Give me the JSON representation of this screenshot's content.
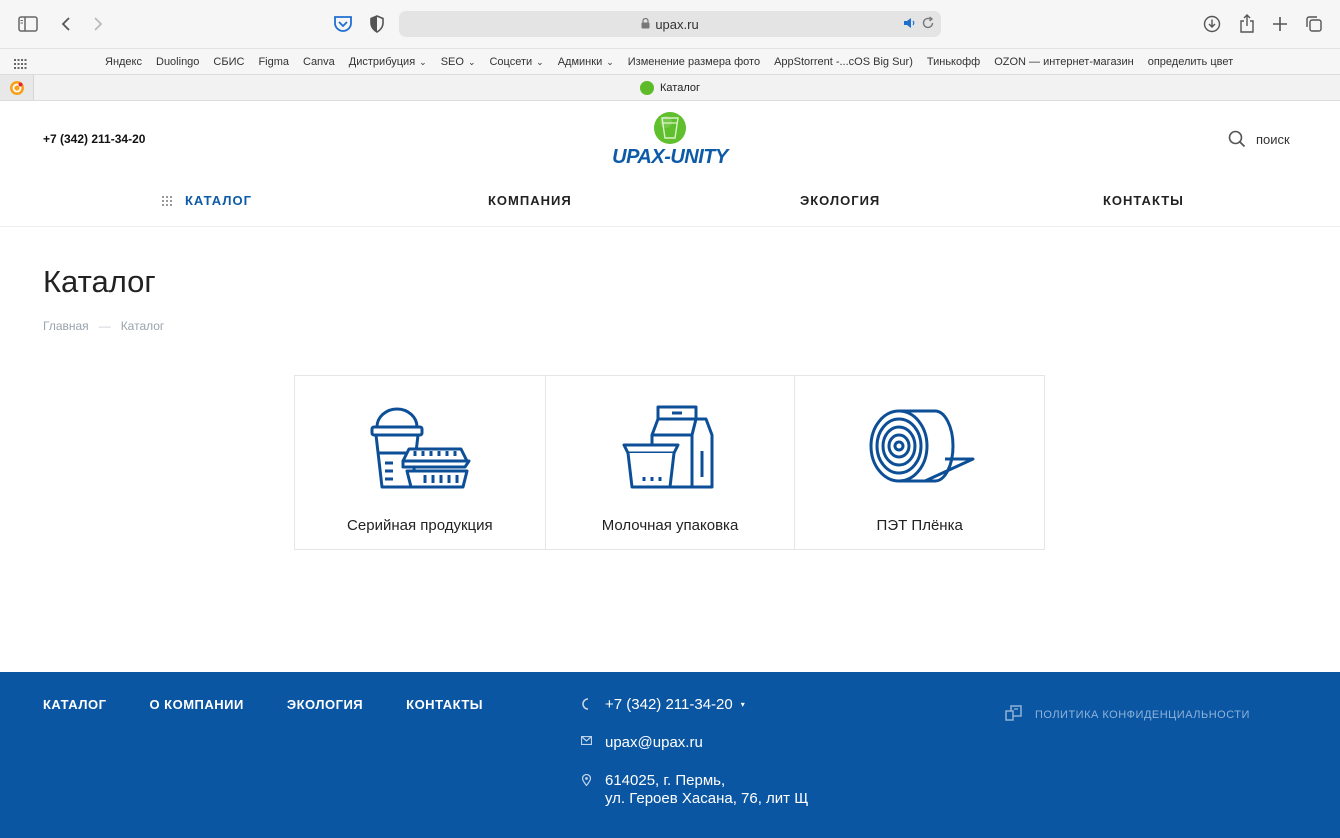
{
  "browser": {
    "url": "upax.ru",
    "bookmarks": [
      {
        "label": "Яндекс",
        "dropdown": false
      },
      {
        "label": "Duolingo",
        "dropdown": false
      },
      {
        "label": "СБИС",
        "dropdown": false
      },
      {
        "label": "Figma",
        "dropdown": false
      },
      {
        "label": "Canva",
        "dropdown": false
      },
      {
        "label": "Дистрибуция",
        "dropdown": true
      },
      {
        "label": "SEO",
        "dropdown": true
      },
      {
        "label": "Соцсети",
        "dropdown": true
      },
      {
        "label": "Админки",
        "dropdown": true
      },
      {
        "label": "Изменение размера фото",
        "dropdown": false
      },
      {
        "label": "AppStorrent -...cOS Big Sur)",
        "dropdown": false
      },
      {
        "label": "Тинькофф",
        "dropdown": false
      },
      {
        "label": "OZON — интернет-магазин",
        "dropdown": false
      },
      {
        "label": "определить цвет",
        "dropdown": false
      }
    ],
    "tab_title": "Каталог"
  },
  "header": {
    "phone": "+7 (342) 211-34-20",
    "logo_text": "UPAX-UNITY",
    "search_label": "поиск"
  },
  "nav": {
    "catalog": "КАТАЛОГ",
    "company": "КОМПАНИЯ",
    "ecology": "ЭКОЛОГИЯ",
    "contacts": "КОНТАКТЫ"
  },
  "page": {
    "title": "Каталог",
    "breadcrumbs": [
      "Главная",
      "Каталог"
    ]
  },
  "categories": [
    {
      "label": "Серийная продукция",
      "icon": "disposable-containers-icon"
    },
    {
      "label": "Молочная упаковка",
      "icon": "milk-carton-icon"
    },
    {
      "label": "ПЭТ Плёнка",
      "icon": "film-roll-icon"
    }
  ],
  "footer": {
    "nav": [
      "КАТАЛОГ",
      "О КОМПАНИИ",
      "ЭКОЛОГИЯ",
      "КОНТАКТЫ"
    ],
    "phone": "+7 (342) 211-34-20",
    "email": "upax@upax.ru",
    "address_line1": "614025, г. Пермь,",
    "address_line2": "ул. Героев Хасана, 76, лит Щ",
    "policy": "ПОЛИТИКА КОНФИДЕНЦИАЛЬНОСТИ"
  },
  "colors": {
    "brand_blue": "#0a56a3",
    "brand_green": "#5fbf2c",
    "nav_active": "#0d5aa7"
  }
}
